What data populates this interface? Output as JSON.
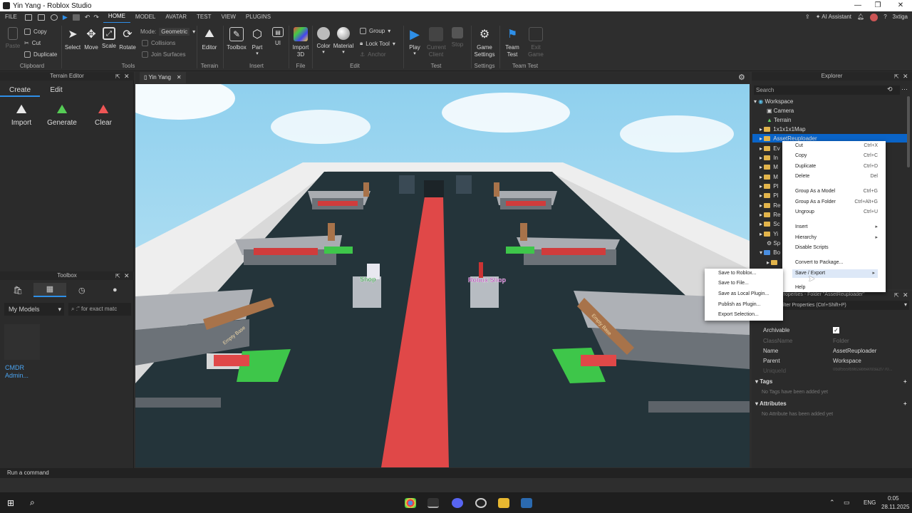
{
  "window": {
    "title": "Yin Yang - Roblox Studio"
  },
  "menu": {
    "file": "FILE",
    "tabs": [
      "HOME",
      "MODEL",
      "AVATAR",
      "TEST",
      "VIEW",
      "PLUGINS"
    ],
    "ai_assistant": "AI Assistant",
    "username": "3xtiga"
  },
  "ribbon": {
    "clipboard": {
      "paste": "Paste",
      "copy": "Copy",
      "cut": "Cut",
      "duplicate": "Duplicate",
      "label": "Clipboard"
    },
    "tools": {
      "select": "Select",
      "move": "Move",
      "scale": "Scale",
      "rotate": "Rotate",
      "mode_label": "Mode:",
      "mode_value": "Geometric",
      "collisions": "Collisions",
      "join_surfaces": "Join Surfaces",
      "label": "Tools"
    },
    "terrain": {
      "editor": "Editor",
      "label": "Terrain"
    },
    "insert": {
      "toolbox": "Toolbox",
      "part": "Part",
      "ui": "UI",
      "label": "Insert"
    },
    "file": {
      "import3d": "Import 3D",
      "label": "File"
    },
    "edit": {
      "color": "Color",
      "material": "Material",
      "group": "Group",
      "lock_tool": "Lock Tool",
      "anchor": "Anchor",
      "label": "Edit"
    },
    "test": {
      "play": "Play",
      "current_client": "Current Client",
      "stop": "Stop",
      "label": "Test"
    },
    "settings": {
      "game_settings": "Game Settings",
      "label": "Settings"
    },
    "team_test": {
      "team_test": "Team Test",
      "exit_game": "Exit Game",
      "label": "Team Test"
    }
  },
  "terrain_editor": {
    "title": "Terrain Editor",
    "tabs": [
      "Create",
      "Edit"
    ],
    "buttons": [
      "Import",
      "Generate",
      "Clear"
    ]
  },
  "toolbox": {
    "title": "Toolbox",
    "category": "My Models",
    "search_placeholder": ":\" for exact matc",
    "items": [
      {
        "label": "CMDR Admin..."
      }
    ]
  },
  "viewport": {
    "tab": "Yin Yang",
    "labels": [
      "Shop",
      "Robux Shop",
      "Empty Base",
      "Empty Base"
    ]
  },
  "explorer": {
    "title": "Explorer",
    "search_placeholder": "Search",
    "tree": [
      "Workspace",
      "Camera",
      "Terrain",
      "1x1x1x1Map",
      "AssetReuploader",
      "Ev",
      "In",
      "M",
      "M",
      "Pl",
      "Pl",
      "Re",
      "Re",
      "Sc",
      "Yi",
      "Sp",
      "Bo",
      ""
    ]
  },
  "context_menu": {
    "items": [
      {
        "label": "Cut",
        "shortcut": "Ctrl+X"
      },
      {
        "label": "Copy",
        "shortcut": "Ctrl+C"
      },
      {
        "label": "Duplicate",
        "shortcut": "Ctrl+D"
      },
      {
        "label": "Delete",
        "shortcut": "Del"
      },
      {
        "label": "Group As a Model",
        "shortcut": "Ctrl+G"
      },
      {
        "label": "Group As a Folder",
        "shortcut": "Ctrl+Alt+G"
      },
      {
        "label": "Ungroup",
        "shortcut": "Ctrl+U"
      },
      {
        "label": "Insert",
        "shortcut": ""
      },
      {
        "label": "Hierarchy",
        "shortcut": ""
      },
      {
        "label": "Disable Scripts",
        "shortcut": ""
      },
      {
        "label": "Convert to Package...",
        "shortcut": ""
      },
      {
        "label": "Save / Export",
        "shortcut": ""
      },
      {
        "label": "Help",
        "shortcut": ""
      }
    ],
    "submenu": [
      "Save to Roblox...",
      "Save to File...",
      "Save as Local Plugin...",
      "Publish as Plugin...",
      "Export Selection..."
    ]
  },
  "properties": {
    "title": "Properties - Folder \"AssetReuploader\"",
    "filter_placeholder": "Filter Properties (Ctrl+Shift+P)",
    "rows": [
      {
        "name": "Archivable",
        "value": ""
      },
      {
        "name": "ClassName",
        "value": "Folder"
      },
      {
        "name": "Name",
        "value": "AssetReuploader"
      },
      {
        "name": "Parent",
        "value": "Workspace"
      },
      {
        "name": "UniqueId",
        "value": "0bdf555fb982eb6e093a2f770..."
      }
    ],
    "tags_header": "Tags",
    "tags_empty": "No Tags have been added yet",
    "attributes_header": "Attributes",
    "attributes_empty": "No Attribute has been added yet"
  },
  "command_bar": {
    "placeholder": "Run a command"
  },
  "taskbar": {
    "lang": "ENG",
    "time": "0:05",
    "date": "28.11.2025"
  },
  "colors": {
    "accent": "#2e8fe8",
    "selection": "#0a64c8",
    "folder": "#e2b44b",
    "floor": "#24343a",
    "carpet": "#e04848",
    "sky": "#8fd0ee"
  }
}
